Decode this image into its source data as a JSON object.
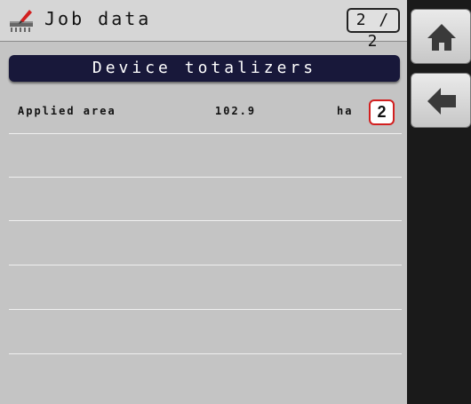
{
  "header": {
    "title": "Job data",
    "page_indicator": "2 / 2",
    "icon": "sprayer-edit-icon"
  },
  "section": {
    "title": "Device totalizers"
  },
  "rows": [
    {
      "label": "Applied area",
      "value": "102.9",
      "unit": "ha",
      "callout": "2"
    }
  ],
  "sidebar": {
    "buttons": [
      {
        "icon": "home-icon"
      },
      {
        "icon": "back-arrow-icon"
      }
    ]
  },
  "colors": {
    "header_bar": "#18183a",
    "callout_border": "#d21f1f",
    "screen_bg": "#c4c4c4"
  }
}
